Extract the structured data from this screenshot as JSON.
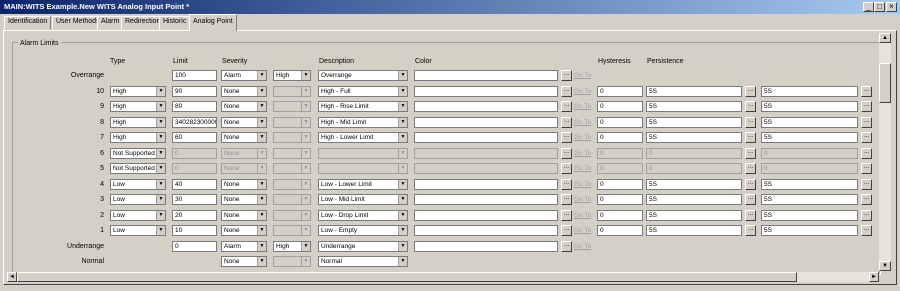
{
  "window": {
    "title": "MAIN:WITS Example.New WITS Analog Input Point *",
    "minimize": "_",
    "maximize": "□",
    "close": "×"
  },
  "tabs": [
    "Identification",
    "User Methods",
    "Alarm",
    "Redirection",
    "Historic",
    "Analog Point"
  ],
  "active_tab": "Analog Point",
  "group_title": "Alarm Limits",
  "headers": {
    "type": "Type",
    "limit": "Limit",
    "severity": "Severity",
    "description": "Description",
    "color": "Color",
    "hysteresis": "Hysteresis",
    "persistence": "Persistence"
  },
  "goto_label": "Go To",
  "ellipsis": "...",
  "rows": [
    {
      "label": "Overrange",
      "type": "",
      "limit": "100",
      "severity": "Alarm",
      "severity2": "High",
      "description": "Overrange",
      "hysteresis": "",
      "p1": "",
      "p2": ""
    },
    {
      "label": "10",
      "type": "High",
      "limit": "90",
      "severity": "None",
      "severity2": "",
      "description": "High - Full",
      "hysteresis": "0",
      "p1": "5S",
      "p2": "5S"
    },
    {
      "label": "9",
      "type": "High",
      "limit": "80",
      "severity": "None",
      "severity2": "",
      "description": "High - Rise Limit",
      "hysteresis": "0",
      "p1": "5S",
      "p2": "5S"
    },
    {
      "label": "8",
      "type": "High",
      "limit": "3402823000000",
      "severity": "None",
      "severity2": "",
      "description": "High - Mid Limit",
      "hysteresis": "0",
      "p1": "5S",
      "p2": "5S"
    },
    {
      "label": "7",
      "type": "High",
      "limit": "60",
      "severity": "None",
      "severity2": "",
      "description": "High - Lower Limit",
      "hysteresis": "0",
      "p1": "5S",
      "p2": "5S"
    },
    {
      "label": "6",
      "type": "Not Supported",
      "limit": "0",
      "severity": "None",
      "severity2": "",
      "description": "",
      "hysteresis": "0",
      "p1": "0",
      "p2": "0"
    },
    {
      "label": "5",
      "type": "Not Supported",
      "limit": "0",
      "severity": "None",
      "severity2": "",
      "description": "",
      "hysteresis": "0",
      "p1": "0",
      "p2": "0"
    },
    {
      "label": "4",
      "type": "Low",
      "limit": "40",
      "severity": "None",
      "severity2": "",
      "description": "Low - Lower Limit",
      "hysteresis": "0",
      "p1": "5S",
      "p2": "5S"
    },
    {
      "label": "3",
      "type": "Low",
      "limit": "30",
      "severity": "None",
      "severity2": "",
      "description": "Low - Mid Limit",
      "hysteresis": "0",
      "p1": "5S",
      "p2": "5S"
    },
    {
      "label": "2",
      "type": "Low",
      "limit": "20",
      "severity": "None",
      "severity2": "",
      "description": "Low - Drop Limit",
      "hysteresis": "0",
      "p1": "5S",
      "p2": "5S"
    },
    {
      "label": "1",
      "type": "Low",
      "limit": "10",
      "severity": "None",
      "severity2": "",
      "description": "Low - Empty",
      "hysteresis": "0",
      "p1": "5S",
      "p2": "5S"
    },
    {
      "label": "Underrange",
      "type": "",
      "limit": "0",
      "severity": "Alarm",
      "severity2": "High",
      "description": "Underrange",
      "hysteresis": "",
      "p1": "",
      "p2": ""
    },
    {
      "label": "Normal",
      "type": "",
      "limit": "",
      "severity": "None",
      "severity2": "",
      "description": "Normal",
      "hysteresis": "",
      "p1": "",
      "p2": ""
    }
  ],
  "scroll": {
    "up": "▲",
    "down": "▼",
    "left": "◄",
    "right": "►"
  }
}
